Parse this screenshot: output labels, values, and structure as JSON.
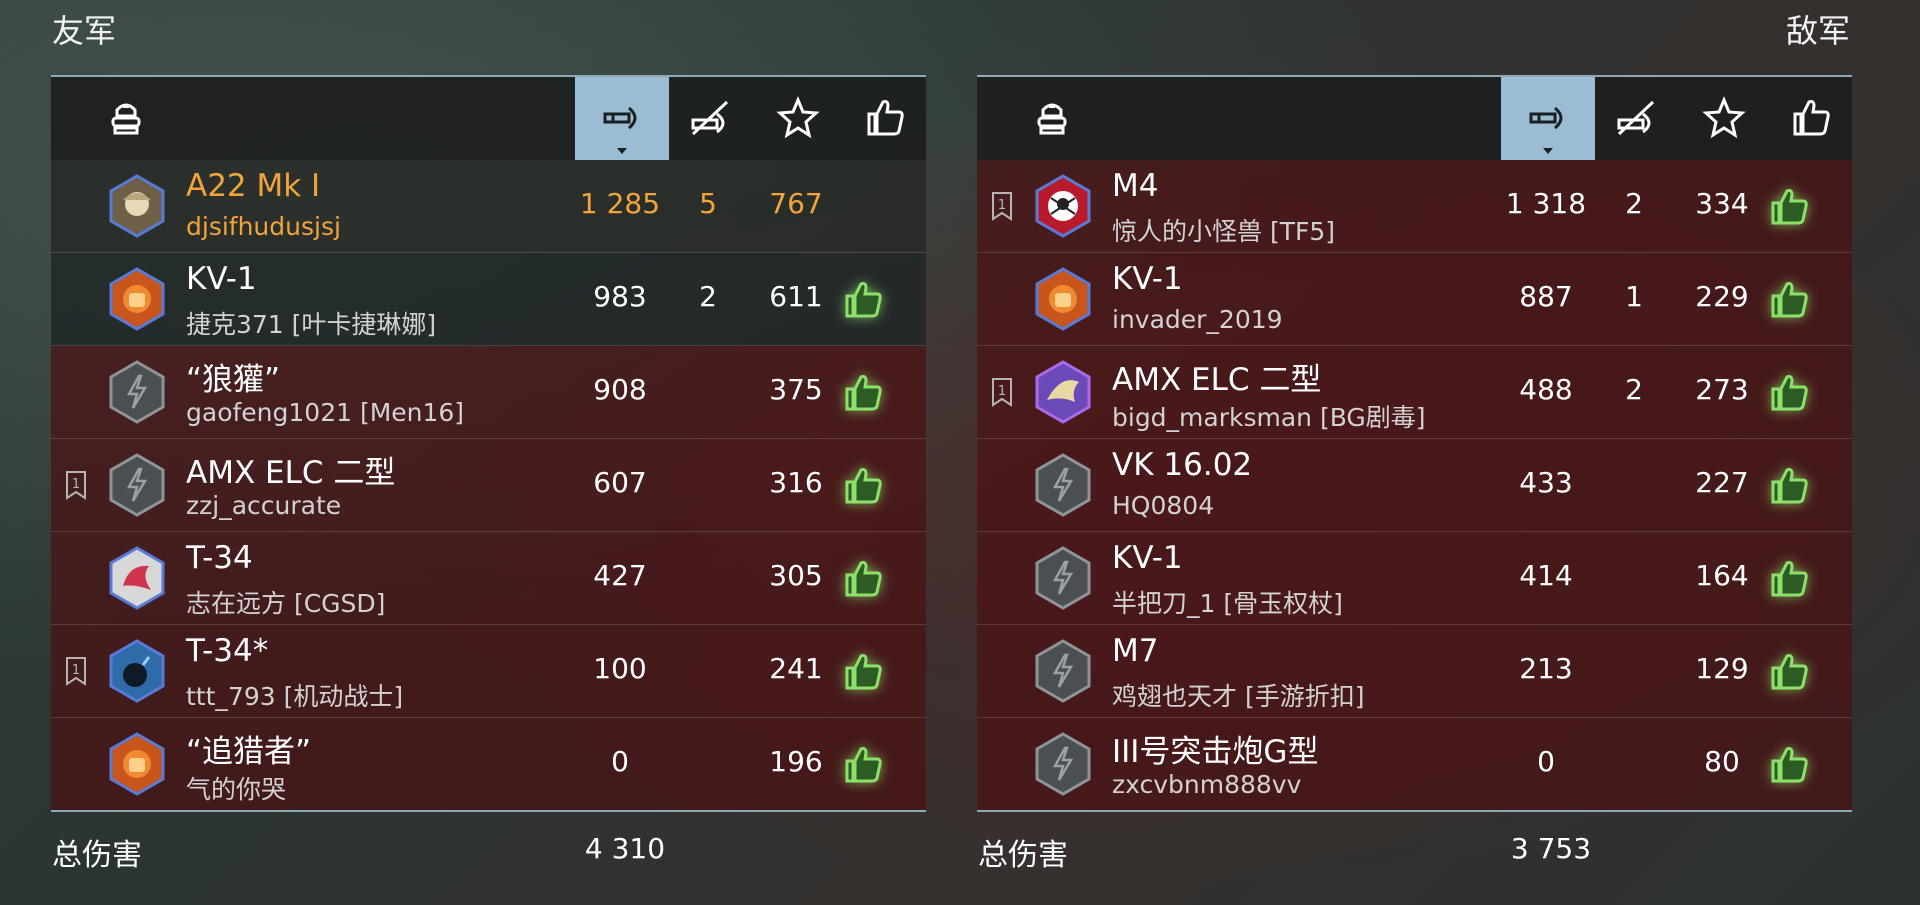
{
  "friendly": {
    "title": "友军",
    "total_label": "总伤害",
    "total_value": "4 310",
    "header_icons": [
      "tank-icon",
      "damage-icon",
      "kills-icon",
      "star-icon",
      "thumbs-up-icon"
    ],
    "sorted_column": "damage",
    "rows": [
      {
        "tank": "A22 Mk I",
        "player": "djsifhudusjsj",
        "damage": "1 285",
        "kills": "5",
        "xp": "767",
        "platoon": false,
        "avatar": "soldier",
        "self": true,
        "liked": false
      },
      {
        "tank": "KV-1",
        "player": "捷克371 [叶卡捷琳娜]",
        "damage": "983",
        "kills": "2",
        "xp": "611",
        "platoon": false,
        "avatar": "fist",
        "self": false,
        "liked": true
      },
      {
        "tank": "“狼獾”",
        "player": "gaofeng1021 [Men16]",
        "damage": "908",
        "kills": "",
        "xp": "375",
        "platoon": false,
        "avatar": "default",
        "self": false,
        "liked": true
      },
      {
        "tank": "AMX ELC 二型",
        "player": "zzj_accurate",
        "damage": "607",
        "kills": "",
        "xp": "316",
        "platoon": true,
        "avatar": "default",
        "self": false,
        "liked": true
      },
      {
        "tank": "T-34",
        "player": "志在远方 [CGSD]",
        "damage": "427",
        "kills": "",
        "xp": "305",
        "platoon": false,
        "avatar": "splash",
        "self": false,
        "liked": true
      },
      {
        "tank": "T-34*",
        "player": "ttt_793 [机动战士]",
        "damage": "100",
        "kills": "",
        "xp": "241",
        "platoon": true,
        "avatar": "bomb",
        "self": false,
        "liked": true
      },
      {
        "tank": "“追猎者”",
        "player": "气的你哭",
        "damage": "0",
        "kills": "",
        "xp": "196",
        "platoon": false,
        "avatar": "fist",
        "self": false,
        "liked": true
      }
    ]
  },
  "enemy": {
    "title": "敌军",
    "total_label": "总伤害",
    "total_value": "3 753",
    "header_icons": [
      "tank-icon",
      "damage-icon",
      "kills-icon",
      "star-icon",
      "thumbs-up-icon"
    ],
    "sorted_column": "damage",
    "rows": [
      {
        "tank": "M4",
        "player": "惊人的小怪兽 [TF5]",
        "damage": "1 318",
        "kills": "2",
        "xp": "334",
        "platoon": true,
        "avatar": "spider",
        "self": false,
        "liked": true
      },
      {
        "tank": "KV-1",
        "player": "invader_2019",
        "damage": "887",
        "kills": "1",
        "xp": "229",
        "platoon": false,
        "avatar": "fist",
        "self": false,
        "liked": true
      },
      {
        "tank": "AMX ELC 二型",
        "player": "bigd_marksman [BG剧毒]",
        "damage": "488",
        "kills": "2",
        "xp": "273",
        "platoon": true,
        "avatar": "eagle",
        "self": false,
        "liked": true
      },
      {
        "tank": "VK 16.02",
        "player": "HQ0804",
        "damage": "433",
        "kills": "",
        "xp": "227",
        "platoon": false,
        "avatar": "default",
        "self": false,
        "liked": true
      },
      {
        "tank": "KV-1",
        "player": "半把刀_1 [骨玉权杖]",
        "damage": "414",
        "kills": "",
        "xp": "164",
        "platoon": false,
        "avatar": "default",
        "self": false,
        "liked": true
      },
      {
        "tank": "M7",
        "player": "鸡翅也天才 [手游折扣]",
        "damage": "213",
        "kills": "",
        "xp": "129",
        "platoon": false,
        "avatar": "default",
        "self": false,
        "liked": true
      },
      {
        "tank": "III号突击炮G型",
        "player": "zxcvbnm888vv",
        "damage": "0",
        "kills": "",
        "xp": "80",
        "platoon": false,
        "avatar": "default",
        "self": false,
        "liked": true
      }
    ]
  },
  "colors": {
    "self_highlight": "#f0a43a",
    "enemy_row": "#4b1014",
    "sorted_header": "#9cbcd4",
    "like_green": "#8de06a"
  }
}
